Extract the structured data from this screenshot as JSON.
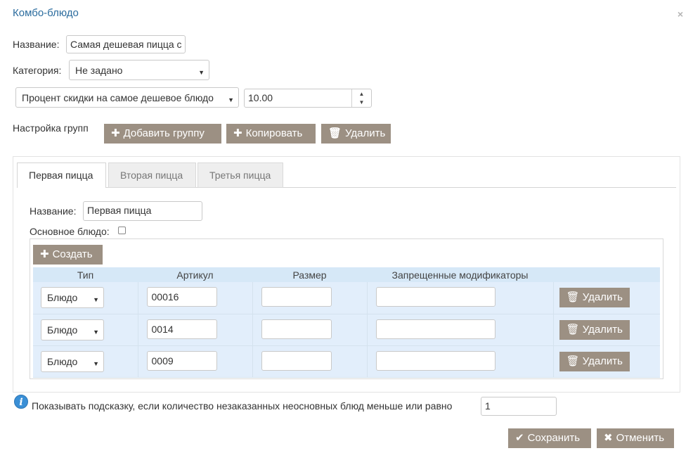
{
  "dialog": {
    "title": "Комбо-блюдо",
    "close_glyph": "×"
  },
  "form": {
    "name_label": "Название:",
    "name_value": "Самая дешевая пицца с",
    "category_label": "Категория:",
    "category_value": "Не задано",
    "discount_type_value": "Процент скидки на самое дешевое блюдо",
    "discount_amount_value": "10.00"
  },
  "groups": {
    "label": "Настройка групп",
    "add_button": "Добавить группу",
    "copy_button": "Копировать",
    "delete_button": "Удалить"
  },
  "tabs": [
    {
      "label": "Первая пицца",
      "active": true
    },
    {
      "label": "Вторая пицца",
      "active": false
    },
    {
      "label": "Третья пицца",
      "active": false
    }
  ],
  "group": {
    "name_label": "Название:",
    "name_value": "Первая пицца",
    "main_dish_label": "Основное блюдо:",
    "main_dish_checked": false,
    "create_button": "Создать"
  },
  "table": {
    "columns": [
      "Тип",
      "Артикул",
      "Размер",
      "Запрещенные модификаторы",
      ""
    ],
    "rows": [
      {
        "type": "Блюдо",
        "article": "00016",
        "size": "",
        "forbidden": "",
        "delete": "Удалить"
      },
      {
        "type": "Блюдо",
        "article": "0014",
        "size": "",
        "forbidden": "",
        "delete": "Удалить"
      },
      {
        "type": "Блюдо",
        "article": "0009",
        "size": "",
        "forbidden": "",
        "delete": "Удалить"
      }
    ]
  },
  "hint": {
    "icon": "info-icon",
    "text": "Показывать подсказку, если количество незаказанных неосновных блюд меньше или равно",
    "value": "1"
  },
  "footer": {
    "save_button": "Сохранить",
    "cancel_button": "Отменить"
  },
  "colors": {
    "title": "#2b6c9e",
    "button": "#9c9083",
    "table_header": "#d6e8f7",
    "table_row": "#e2eefb",
    "info": "#3a8fd6"
  }
}
